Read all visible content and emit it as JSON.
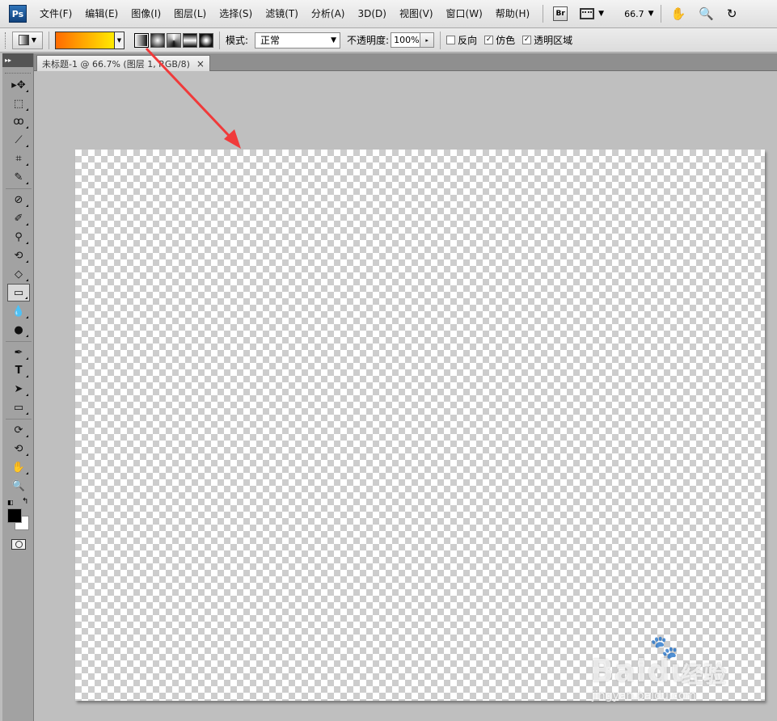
{
  "app": {
    "logo": "Ps"
  },
  "menubar": {
    "items": [
      "文件(F)",
      "编辑(E)",
      "图像(I)",
      "图层(L)",
      "选择(S)",
      "滤镜(T)",
      "分析(A)",
      "3D(D)",
      "视图(V)",
      "窗口(W)",
      "帮助(H)"
    ],
    "bridge_label": "Br",
    "zoom_value": "66.7"
  },
  "options": {
    "mode_label": "模式:",
    "mode_value": "正常",
    "opacity_label": "不透明度:",
    "opacity_value": "100%",
    "reverse_label": "反向",
    "reverse_checked": false,
    "dither_label": "仿色",
    "dither_checked": true,
    "transparency_label": "透明区域",
    "transparency_checked": true,
    "gradient_colors": [
      "#ff6a00",
      "#ffea00"
    ]
  },
  "document": {
    "tab_title": "未标题-1 @ 66.7% (图层 1, RGB/8)",
    "close_glyph": "×"
  },
  "tools": [
    {
      "name": "move-tool-icon",
      "glyph": "▸✥"
    },
    {
      "name": "marquee-tool-icon",
      "glyph": "⬚"
    },
    {
      "name": "lasso-tool-icon",
      "glyph": "ꝏ"
    },
    {
      "name": "quick-selection-tool-icon",
      "glyph": "⟋"
    },
    {
      "name": "crop-tool-icon",
      "glyph": "⌗"
    },
    {
      "name": "eyedropper-tool-icon",
      "glyph": "✎"
    },
    {
      "name": "healing-brush-tool-icon",
      "glyph": "⊘"
    },
    {
      "name": "brush-tool-icon",
      "glyph": "✐"
    },
    {
      "name": "clone-stamp-tool-icon",
      "glyph": "⚲"
    },
    {
      "name": "history-brush-tool-icon",
      "glyph": "⟲"
    },
    {
      "name": "eraser-tool-icon",
      "glyph": "◇"
    },
    {
      "name": "gradient-tool-icon",
      "glyph": "▭"
    },
    {
      "name": "blur-tool-icon",
      "glyph": "💧"
    },
    {
      "name": "dodge-tool-icon",
      "glyph": "●"
    },
    {
      "name": "pen-tool-icon",
      "glyph": "✒"
    },
    {
      "name": "type-tool-icon",
      "glyph": "T"
    },
    {
      "name": "path-selection-tool-icon",
      "glyph": "➤"
    },
    {
      "name": "shape-tool-icon",
      "glyph": "▭"
    },
    {
      "name": "3d-rotate-tool-icon",
      "glyph": "⟳"
    },
    {
      "name": "3d-orbit-tool-icon",
      "glyph": "⟲"
    },
    {
      "name": "hand-tool-icon",
      "glyph": "✋"
    },
    {
      "name": "zoom-tool-icon",
      "glyph": "🔍"
    }
  ],
  "watermark": {
    "brand": "Bai",
    "brand2": "du",
    "cn": "经验",
    "url": "jingyan.baidu.com"
  }
}
